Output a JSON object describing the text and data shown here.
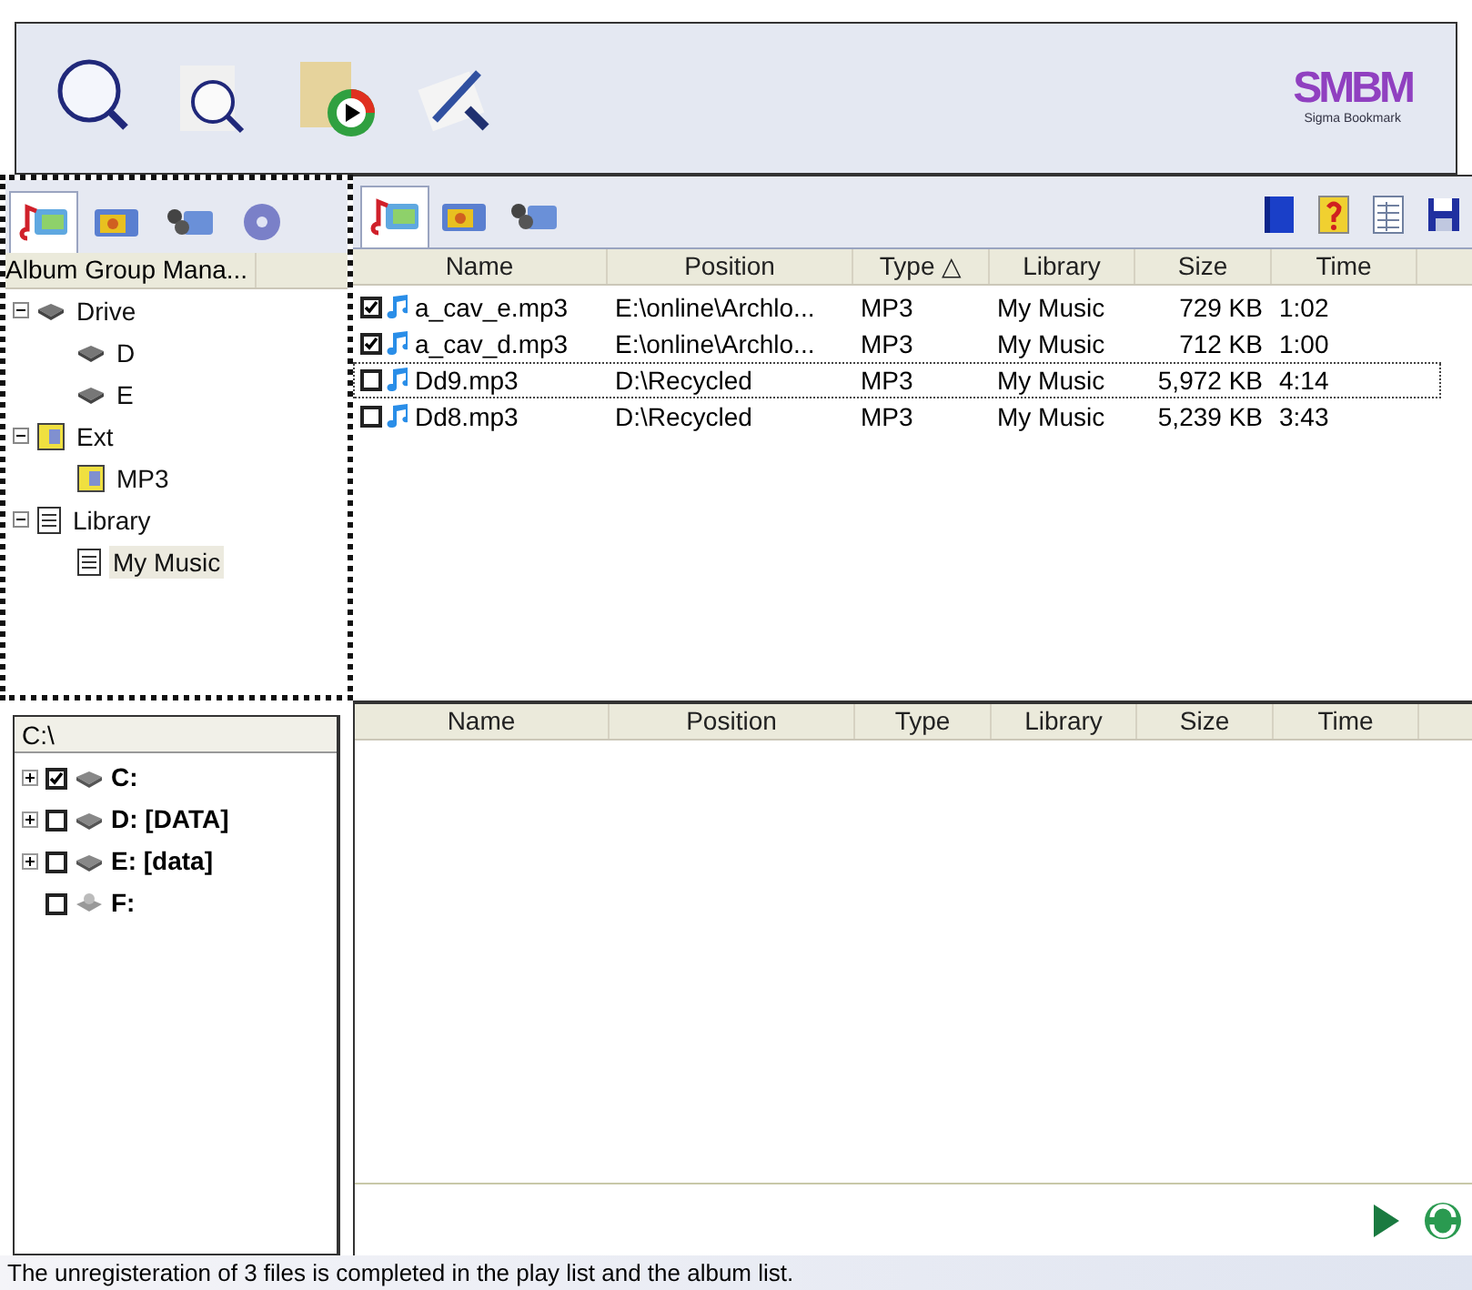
{
  "toolbar": {
    "logo": {
      "letters": "SMBM",
      "caption": "Sigma Bookmark"
    }
  },
  "album_panel": {
    "tabs": [
      {
        "kind": "music",
        "selected": true
      },
      {
        "kind": "photo",
        "selected": false
      },
      {
        "kind": "video",
        "selected": false
      },
      {
        "kind": "disc",
        "selected": false
      }
    ],
    "header": "Album Group Mana...",
    "tree": [
      {
        "label": "Drive",
        "kind": "drive",
        "expanded": true,
        "selected": false,
        "children": [
          {
            "label": "D",
            "kind": "drive",
            "selected": false
          },
          {
            "label": "E",
            "kind": "drive",
            "selected": false
          }
        ]
      },
      {
        "label": "Ext",
        "kind": "ext",
        "expanded": true,
        "selected": false,
        "children": [
          {
            "label": "MP3",
            "kind": "ext",
            "selected": false
          }
        ]
      },
      {
        "label": "Library",
        "kind": "library",
        "expanded": true,
        "selected": false,
        "children": [
          {
            "label": "My Music",
            "kind": "library",
            "selected": true
          }
        ]
      }
    ]
  },
  "folder_panel": {
    "header": "C:\\",
    "drives": [
      {
        "label": "C:",
        "checked": true,
        "expandable": true,
        "kind": "disk"
      },
      {
        "label": "D: [DATA]",
        "checked": false,
        "expandable": true,
        "kind": "disk"
      },
      {
        "label": "E: [data]",
        "checked": false,
        "expandable": true,
        "kind": "disk"
      },
      {
        "label": "F:",
        "checked": false,
        "expandable": false,
        "kind": "removable"
      }
    ]
  },
  "playlist": {
    "tabs": [
      {
        "kind": "music",
        "selected": true
      },
      {
        "kind": "photo",
        "selected": false
      },
      {
        "kind": "video",
        "selected": false
      }
    ],
    "tools": [
      {
        "kind": "book"
      },
      {
        "kind": "help"
      },
      {
        "kind": "table"
      },
      {
        "kind": "save"
      }
    ],
    "columns": [
      "Name",
      "Position",
      "Type △",
      "Library",
      "Size",
      "Time"
    ],
    "rows": [
      {
        "checked": true,
        "focused": false,
        "cells": [
          "a_cav_e.mp3",
          "E:\\online\\Archlo...",
          "MP3",
          "My Music",
          "729 KB",
          "1:02"
        ]
      },
      {
        "checked": true,
        "focused": false,
        "cells": [
          "a_cav_d.mp3",
          "E:\\online\\Archlo...",
          "MP3",
          "My Music",
          "712 KB",
          "1:00"
        ]
      },
      {
        "checked": false,
        "focused": true,
        "cells": [
          "Dd9.mp3",
          "D:\\Recycled",
          "MP3",
          "My Music",
          "5,972 KB",
          "4:14"
        ]
      },
      {
        "checked": false,
        "focused": false,
        "cells": [
          "Dd8.mp3",
          "D:\\Recycled",
          "MP3",
          "My Music",
          "5,239 KB",
          "3:43"
        ]
      }
    ]
  },
  "file_list": {
    "columns": [
      "Name",
      "Position",
      "Type",
      "Library",
      "Size",
      "Time"
    ]
  },
  "status_bar": "The unregisteration of 3 files is completed in the play list and the album list."
}
